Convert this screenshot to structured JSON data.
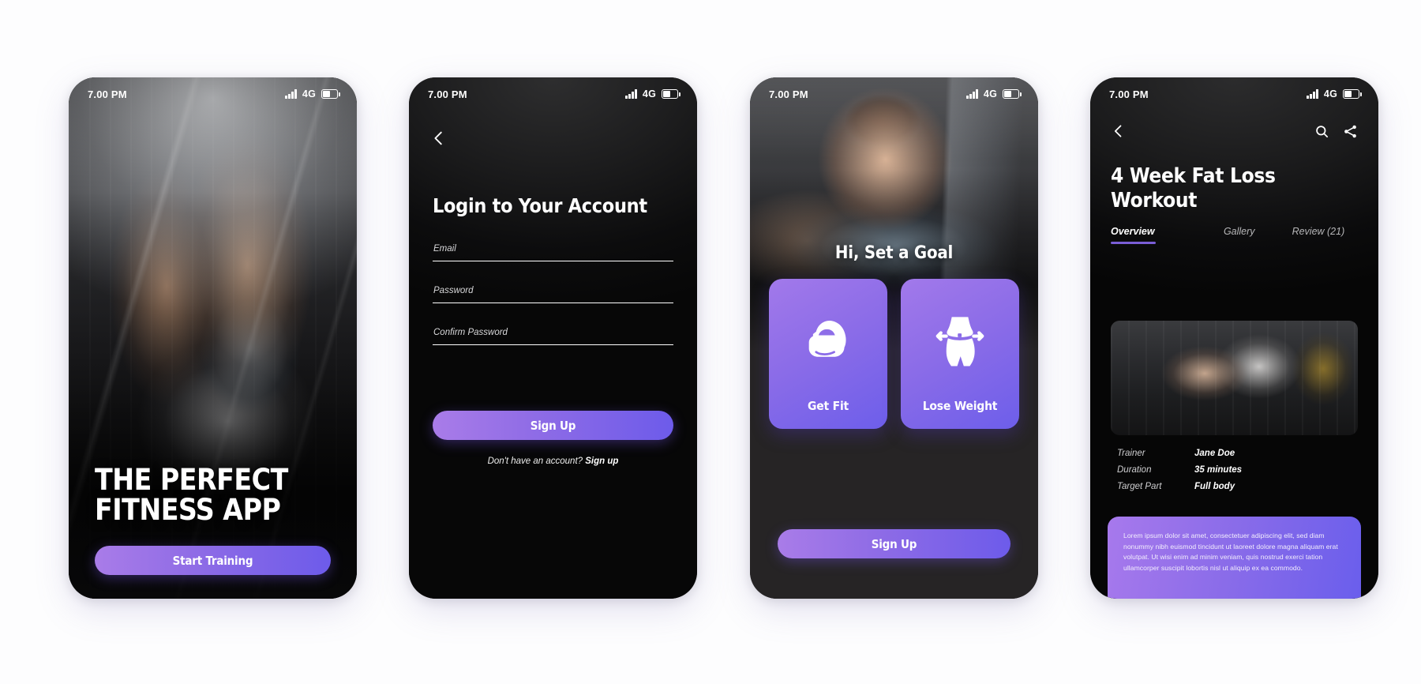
{
  "statusbar": {
    "time": "7.00 PM",
    "network": "4G"
  },
  "screen1": {
    "name": "onboarding-screen",
    "title": "THE PERFECT FITNESS APP",
    "cta": "Start Training"
  },
  "screen2": {
    "name": "login-screen",
    "back_icon": "chevron-left-icon",
    "title": "Login to Your Account",
    "fields": [
      {
        "name": "email-field",
        "placeholder": "Email",
        "value": ""
      },
      {
        "name": "password-field",
        "placeholder": "Password",
        "value": ""
      },
      {
        "name": "confirm-password-field",
        "placeholder": "Confirm Password",
        "value": ""
      }
    ],
    "cta": "Sign Up",
    "footer_text": "Don't have an account?",
    "footer_link": "Sign up"
  },
  "screen3": {
    "name": "set-goal-screen",
    "greeting": "Hi, Set a Goal",
    "goals": [
      {
        "label": "Get Fit",
        "icon": "bicep-flex-icon"
      },
      {
        "label": "Lose Weight",
        "icon": "waist-measure-icon"
      }
    ],
    "cta": "Sign Up"
  },
  "screen4": {
    "name": "workout-detail-screen",
    "back_icon": "chevron-left-icon",
    "search_icon": "search-icon",
    "share_icon": "share-icon",
    "title": "4 Week Fat Loss Workout",
    "tabs": [
      {
        "label": "Overview",
        "active": true
      },
      {
        "label": "Gallery",
        "active": false
      },
      {
        "label": "Review (21)",
        "active": false
      }
    ],
    "info": [
      {
        "key": "Trainer",
        "value": "Jane Doe"
      },
      {
        "key": "Duration",
        "value": "35 minutes"
      },
      {
        "key": "Target Part",
        "value": "Full body"
      }
    ],
    "description": "Lorem ipsum dolor sit amet, consectetuer adipiscing elit, sed diam nonummy nibh euismod tincidunt ut laoreet dolore magna aliquam erat volutpat. Ut wisi enim ad minim veniam, quis nostrud exerci tation ullamcorper suscipit lobortis nisl ut aliquip ex ea commodo."
  },
  "colors": {
    "accent_light": "#a97ce8",
    "accent_dark": "#6d5bea",
    "tab_underline": "#7a5ed6",
    "screen_dark": "#0b0b0c"
  }
}
